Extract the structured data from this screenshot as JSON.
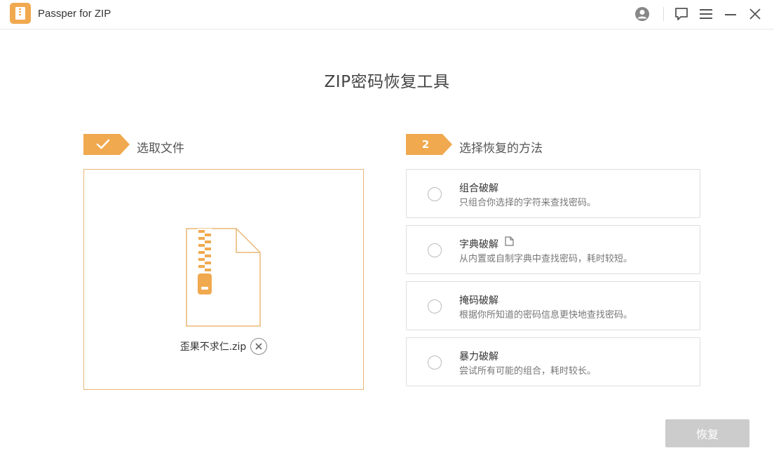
{
  "titlebar": {
    "app_name": "Passper for ZIP",
    "icons": [
      "account-icon",
      "feedback-icon",
      "menu-icon",
      "minimize-icon",
      "close-icon"
    ]
  },
  "page": {
    "title": "ZIP密码恢复工具"
  },
  "step1": {
    "badge_icon": "check-icon",
    "label": "选取文件",
    "file_name": "歪果不求仁.zip"
  },
  "step2": {
    "badge_number": "2",
    "label": "选择恢复的方法",
    "methods": [
      {
        "title": "组合破解",
        "desc": "只组合你选择的字符来查找密码。"
      },
      {
        "title": "字典破解",
        "desc": "从内置或自制字典中查找密码，耗时较短。"
      },
      {
        "title": "掩码破解",
        "desc": "根据你所知道的密码信息更快地查找密码。"
      },
      {
        "title": "暴力破解",
        "desc": "尝试所有可能的组合，耗时较长。"
      }
    ]
  },
  "actions": {
    "recover_label": "恢复"
  },
  "colors": {
    "accent": "#f0a94f",
    "disabled_button": "#cccccc"
  }
}
